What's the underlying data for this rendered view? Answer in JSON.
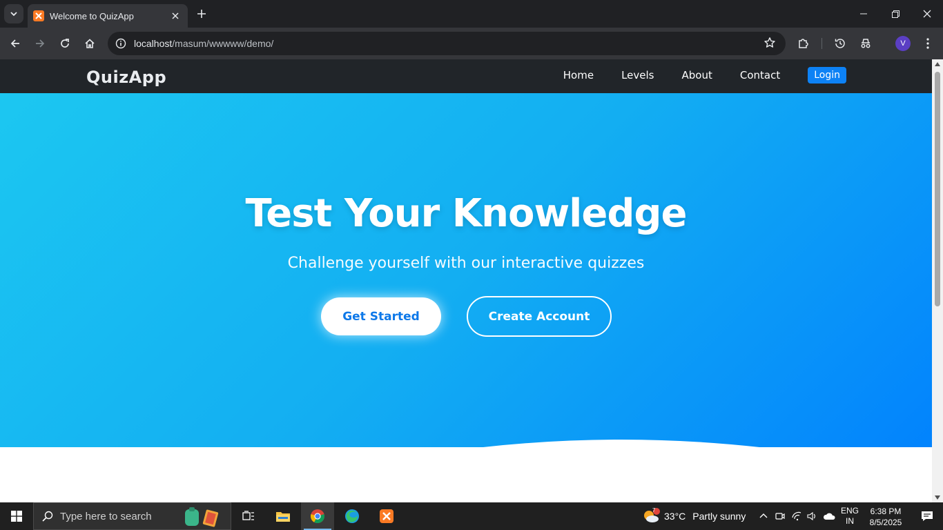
{
  "browser": {
    "tab_title": "Welcome to QuizApp",
    "url_host": "localhost",
    "url_path": "/masum/wwwww/demo/",
    "profile_initial": "V"
  },
  "site": {
    "brand": "QuizApp",
    "nav": {
      "home": "Home",
      "levels": "Levels",
      "about": "About",
      "contact": "Contact",
      "login": "Login"
    },
    "hero": {
      "heading": "Test Your Knowledge",
      "subheading": "Challenge yourself with our interactive quizzes",
      "primary_button": "Get Started",
      "secondary_button": "Create Account"
    },
    "colors": {
      "hero_gradient_start": "#1cc7f1",
      "hero_gradient_end": "#0283fd",
      "navbar": "#212529",
      "login_button": "#0d82f5"
    }
  },
  "taskbar": {
    "search_placeholder": "Type here to search",
    "weather_temp": "33°C",
    "weather_desc": "Partly sunny",
    "weather_badge": "7",
    "lang_line1": "ENG",
    "lang_line2": "IN",
    "time": "6:38 PM",
    "date": "8/5/2025"
  }
}
